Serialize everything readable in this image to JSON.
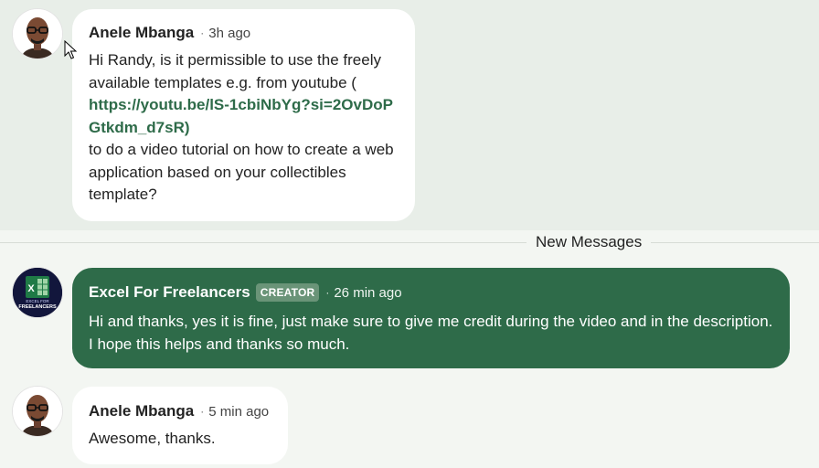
{
  "messages": [
    {
      "author": "Anele Mbanga",
      "time": "3h ago",
      "text_before": "Hi Randy, is it permissible to use the freely available templates e.g. from youtube (",
      "link": "https://youtu.be/lS-1cbiNbYg?si=2OvDoPGtkdm_d7sR)",
      "text_after": "to do a video tutorial on how to create a web application based on your collectibles template?"
    },
    {
      "author": "Excel For Freelancers",
      "badge": "CREATOR",
      "time": "26 min ago",
      "text": "Hi and thanks, yes it is fine, just make sure to give me credit during the video and in the description. I hope this helps and thanks so much."
    },
    {
      "author": "Anele Mbanga",
      "time": "5 min ago",
      "text": "Awesome, thanks."
    }
  ],
  "divider": {
    "label": "New Messages"
  },
  "separator": "·",
  "creator_logo": {
    "line1": "EXCEL FOR",
    "line2": "FREELANCERS",
    "letter": "X"
  },
  "colors": {
    "accent": "#2e6b49",
    "badge": "#6a9478",
    "page_bg": "#f3f6f2",
    "highlight_bg": "#e8eee8",
    "bubble_bg": "#ffffff"
  },
  "icons": [
    "mouse-pointer-icon"
  ]
}
